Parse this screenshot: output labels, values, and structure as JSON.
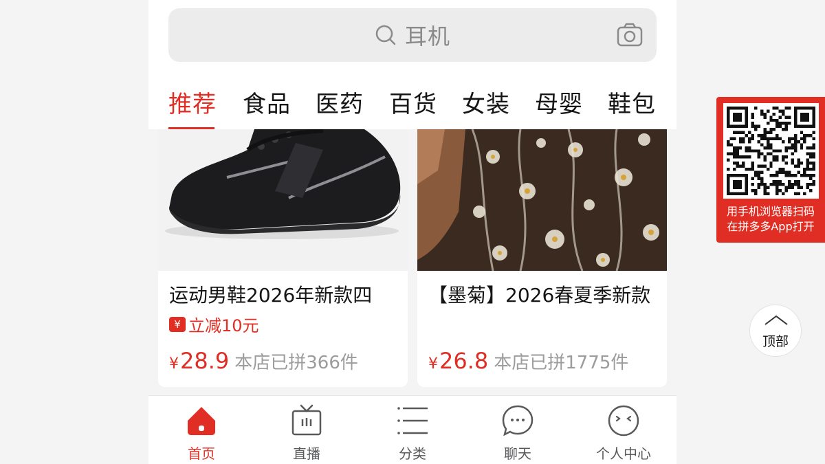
{
  "search": {
    "placeholder_text": "耳机",
    "icon": "search-icon",
    "camera_icon": "camera-icon"
  },
  "tabs": [
    {
      "label": "推荐",
      "active": true
    },
    {
      "label": "食品",
      "active": false
    },
    {
      "label": "医药",
      "active": false
    },
    {
      "label": "百货",
      "active": false
    },
    {
      "label": "女装",
      "active": false
    },
    {
      "label": "母婴",
      "active": false
    },
    {
      "label": "鞋包",
      "active": false
    }
  ],
  "products": [
    {
      "title": "运动男鞋2026年新款四",
      "promo": "立减10元",
      "promo_icon": "¥",
      "currency": "¥",
      "price": "28.9",
      "sold": "本店已拼366件"
    },
    {
      "title": "【墨菊】2026春夏季新款",
      "promo": "",
      "currency": "¥",
      "price": "26.8",
      "sold": "本店已拼1775件"
    }
  ],
  "bottom_nav": [
    {
      "label": "首页",
      "icon": "home-icon",
      "active": true
    },
    {
      "label": "直播",
      "icon": "tv-icon",
      "active": false
    },
    {
      "label": "分类",
      "icon": "list-icon",
      "active": false
    },
    {
      "label": "聊天",
      "icon": "chat-icon",
      "active": false
    },
    {
      "label": "个人中心",
      "icon": "profile-icon",
      "active": false
    }
  ],
  "qr_panel": {
    "line1": "用手机浏览器扫码",
    "line2": "在拼多多App打开"
  },
  "back_to_top": {
    "label": "顶部"
  },
  "colors": {
    "accent": "#e02e24",
    "text": "#151516",
    "muted": "#9c9c9c",
    "background": "#f4f4f4"
  }
}
